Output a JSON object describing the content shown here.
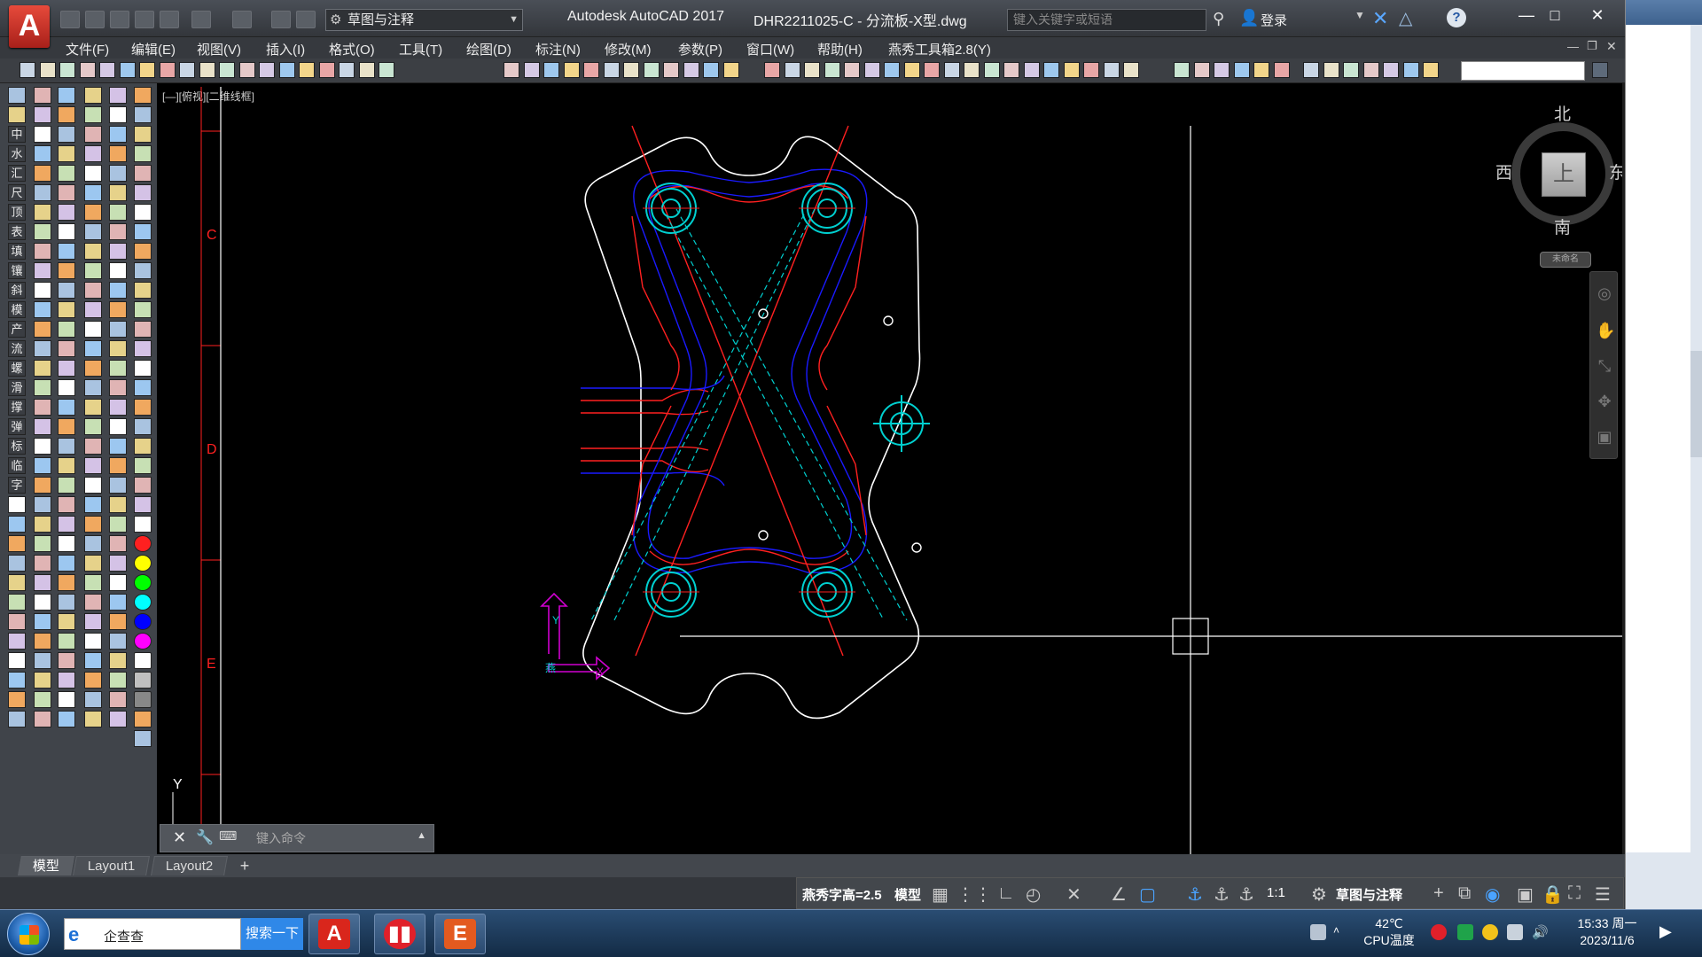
{
  "titlebar": {
    "logo": "A",
    "workspace": "草图与注释",
    "app_name": "Autodesk AutoCAD 2017",
    "document": "DHR2211025-C - 分流板-X型.dwg",
    "search_placeholder": "键入关键字或短语",
    "login": "登录",
    "minimize": "—",
    "maximize": "□",
    "close": "✕"
  },
  "menu": [
    "文件(F)",
    "编辑(E)",
    "视图(V)",
    "插入(I)",
    "格式(O)",
    "工具(T)",
    "绘图(D)",
    "标注(N)",
    "修改(M)",
    "参数(P)",
    "窗口(W)",
    "帮助(H)",
    "燕秀工具箱2.8(Y)"
  ],
  "palette_labels": [
    "中",
    "水",
    "汇",
    "尺",
    "顶",
    "表",
    "填",
    "镶",
    "斜",
    "模",
    "产",
    "流",
    "螺",
    "滑",
    "撑",
    "弹",
    "标",
    "临",
    "字"
  ],
  "canvas": {
    "viewport_label": "[—][俯视][二维线框]",
    "border_letters": [
      "C",
      "D",
      "E"
    ],
    "ucs_y": "Y",
    "ucs_x": "X",
    "ucs_tag": "燕",
    "cursor_label": "Y"
  },
  "viewcube": {
    "north": "北",
    "south": "南",
    "east": "东",
    "west": "西",
    "face": "上",
    "wcs": "未命名"
  },
  "command_line": {
    "placeholder": "键入命令",
    "prompt_glyph": "⌨"
  },
  "layout_tabs": [
    {
      "label": "模型",
      "active": true
    },
    {
      "label": "Layout1",
      "active": false
    },
    {
      "label": "Layout2",
      "active": false
    }
  ],
  "status": {
    "text_height": "燕秀字高=2.5",
    "space": "模型",
    "scale": "1:1",
    "workspace": "草图与注释"
  },
  "taskbar": {
    "search_text": "企查查",
    "search_button": "搜索一下",
    "temp_value": "42℃",
    "temp_label": "CPU温度",
    "time": "15:33 周一",
    "date": "2023/11/6"
  },
  "colors": {
    "outline": "#ffffff",
    "red": "#ff2020",
    "blue": "#1a1aff",
    "cyan": "#00d0d0",
    "magenta": "#d000d0",
    "accent_red": "#d9261c"
  },
  "icons": [
    "app-logo-icon",
    "gear-icon",
    "search-icon",
    "user-icon",
    "help-icon",
    "close-icon",
    "wrench-icon",
    "plus-icon",
    "windows-start-icon"
  ]
}
